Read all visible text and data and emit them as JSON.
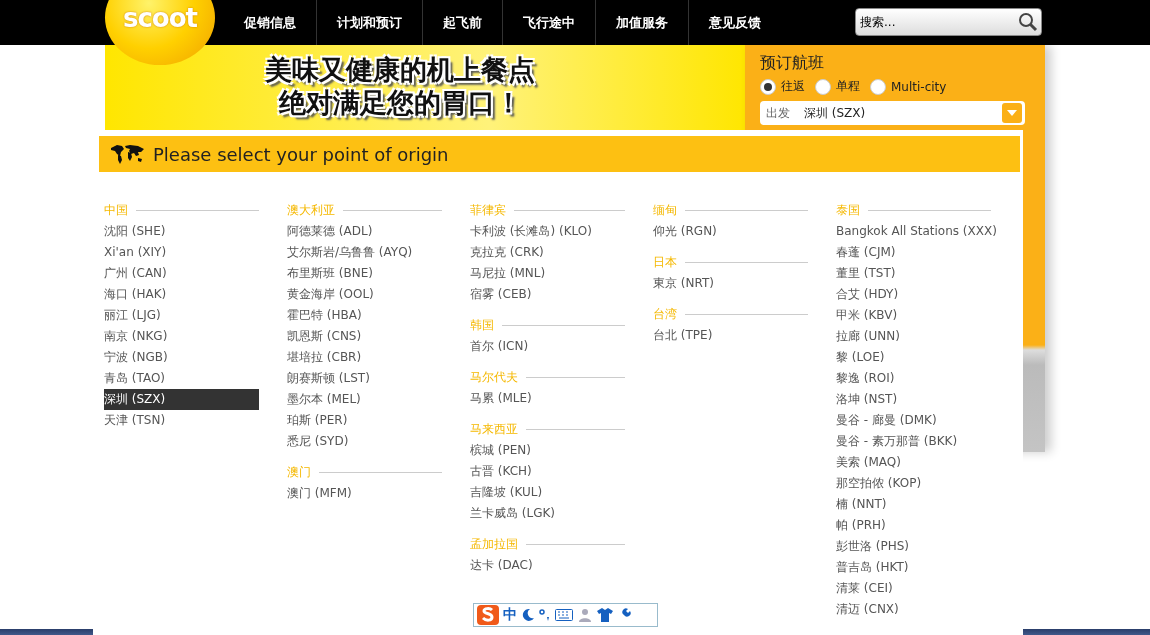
{
  "nav": {
    "logo": "scoot",
    "items": [
      "促销信息",
      "计划和预订",
      "起飞前",
      "飞行途中",
      "加值服务",
      "意见反馈"
    ],
    "search": {
      "placeholder": "搜索..."
    }
  },
  "banner": {
    "lines": [
      "美味又健康的机上餐点",
      "绝对满足您的胃口！"
    ]
  },
  "booking": {
    "title": "预订航班",
    "trip_types": [
      {
        "label": "往返",
        "selected": true
      },
      {
        "label": "单程",
        "selected": false
      },
      {
        "label": "Multi-city",
        "selected": false
      }
    ],
    "origin": {
      "label": "出发",
      "value": "深圳 (SZX)"
    }
  },
  "popup": {
    "title": "Please select your point of origin",
    "columns": [
      {
        "groups": [
          {
            "country": "中国",
            "items": [
              {
                "name": "沈阳 (SHE)",
                "selected": false
              },
              {
                "name": "Xi'an (XIY)",
                "selected": false
              },
              {
                "name": "广州 (CAN)",
                "selected": false
              },
              {
                "name": "海口 (HAK)",
                "selected": false
              },
              {
                "name": "丽江 (LJG)",
                "selected": false
              },
              {
                "name": "南京 (NKG)",
                "selected": false
              },
              {
                "name": "宁波 (NGB)",
                "selected": false
              },
              {
                "name": "青岛 (TAO)",
                "selected": false
              },
              {
                "name": "深圳 (SZX)",
                "selected": true
              },
              {
                "name": "天津 (TSN)",
                "selected": false
              }
            ]
          }
        ]
      },
      {
        "groups": [
          {
            "country": "澳大利亚",
            "items": [
              {
                "name": "阿德莱德 (ADL)",
                "selected": false
              },
              {
                "name": "艾尔斯岩/乌鲁鲁 (AYQ)",
                "selected": false
              },
              {
                "name": "布里斯班 (BNE)",
                "selected": false
              },
              {
                "name": "黄金海岸 (OOL)",
                "selected": false
              },
              {
                "name": "霍巴特 (HBA)",
                "selected": false
              },
              {
                "name": "凯恩斯 (CNS)",
                "selected": false
              },
              {
                "name": "堪培拉 (CBR)",
                "selected": false
              },
              {
                "name": "朗赛斯顿 (LST)",
                "selected": false
              },
              {
                "name": "墨尔本 (MEL)",
                "selected": false
              },
              {
                "name": "珀斯 (PER)",
                "selected": false
              },
              {
                "name": "悉尼 (SYD)",
                "selected": false
              }
            ]
          },
          {
            "country": "澳门",
            "items": [
              {
                "name": "澳门 (MFM)",
                "selected": false
              }
            ]
          }
        ]
      },
      {
        "groups": [
          {
            "country": "菲律宾",
            "items": [
              {
                "name": "卡利波 (长滩岛) (KLO)",
                "selected": false
              },
              {
                "name": "克拉克 (CRK)",
                "selected": false
              },
              {
                "name": "马尼拉 (MNL)",
                "selected": false
              },
              {
                "name": "宿雾 (CEB)",
                "selected": false
              }
            ]
          },
          {
            "country": "韩国",
            "items": [
              {
                "name": "首尔 (ICN)",
                "selected": false
              }
            ]
          },
          {
            "country": "马尔代夫",
            "items": [
              {
                "name": "马累 (MLE)",
                "selected": false
              }
            ]
          },
          {
            "country": "马来西亚",
            "items": [
              {
                "name": "槟城 (PEN)",
                "selected": false
              },
              {
                "name": "古晋 (KCH)",
                "selected": false
              },
              {
                "name": "吉隆坡 (KUL)",
                "selected": false
              },
              {
                "name": "兰卡威岛 (LGK)",
                "selected": false
              }
            ]
          },
          {
            "country": "孟加拉国",
            "items": [
              {
                "name": "达卡 (DAC)",
                "selected": false
              }
            ]
          }
        ]
      },
      {
        "groups": [
          {
            "country": "缅甸",
            "items": [
              {
                "name": "仰光 (RGN)",
                "selected": false
              }
            ]
          },
          {
            "country": "日本",
            "items": [
              {
                "name": "東京 (NRT)",
                "selected": false
              }
            ]
          },
          {
            "country": "台湾",
            "items": [
              {
                "name": "台北 (TPE)",
                "selected": false
              }
            ]
          }
        ]
      },
      {
        "groups": [
          {
            "country": "泰国",
            "items": [
              {
                "name": "Bangkok All Stations (XXX)",
                "selected": false
              },
              {
                "name": "春蓬 (CJM)",
                "selected": false
              },
              {
                "name": "董里 (TST)",
                "selected": false
              },
              {
                "name": "合艾 (HDY)",
                "selected": false
              },
              {
                "name": "甲米 (KBV)",
                "selected": false
              },
              {
                "name": "拉廊 (UNN)",
                "selected": false
              },
              {
                "name": "黎 (LOE)",
                "selected": false
              },
              {
                "name": "黎逸 (ROI)",
                "selected": false
              },
              {
                "name": "洛坤 (NST)",
                "selected": false
              },
              {
                "name": "曼谷 - 廊曼 (DMK)",
                "selected": false
              },
              {
                "name": "曼谷 - 素万那普 (BKK)",
                "selected": false
              },
              {
                "name": "美索 (MAQ)",
                "selected": false
              },
              {
                "name": "那空拍侬 (KOP)",
                "selected": false
              },
              {
                "name": "楠 (NNT)",
                "selected": false
              },
              {
                "name": "帕 (PRH)",
                "selected": false
              },
              {
                "name": "彭世洛 (PHS)",
                "selected": false
              },
              {
                "name": "普吉岛 (HKT)",
                "selected": false
              },
              {
                "name": "清莱 (CEI)",
                "selected": false
              },
              {
                "name": "清迈 (CNX)",
                "selected": false
              }
            ]
          }
        ]
      }
    ]
  },
  "ime": {
    "mode": "中"
  }
}
